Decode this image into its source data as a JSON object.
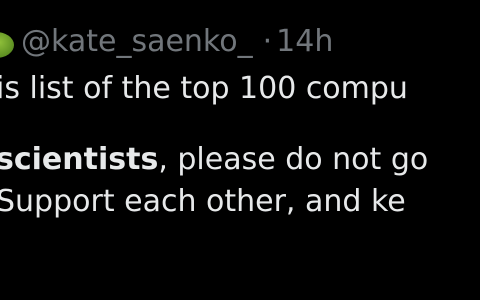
{
  "tweet": {
    "handle": "@kate_saenko_",
    "separator": "·",
    "timestamp": "14h",
    "line1": "is list of the top 100 compu",
    "line3_bold": "scientists",
    "line3_rest": ", please do not go",
    "line4": "Support each other, and ke"
  },
  "colors": {
    "background": "#000000",
    "text": "#e7e9ea",
    "secondary_text": "#71767b",
    "avatar": "#5d8f22"
  },
  "icons": {
    "avatar": "avatar"
  }
}
